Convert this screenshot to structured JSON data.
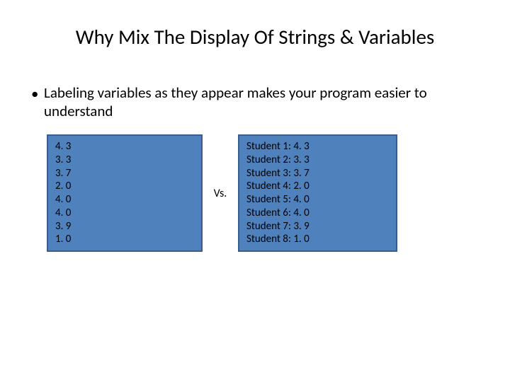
{
  "title": "Why Mix The Display Of Strings & Variables",
  "bullet": "Labeling variables as they appear makes your program easier to understand",
  "vs": "Vs.",
  "left": {
    "values": [
      "4. 3",
      "3. 3",
      "3. 7",
      "2. 0",
      "4. 0",
      "4. 0",
      "3. 9",
      "1. 0"
    ]
  },
  "right": {
    "rows": [
      {
        "label": "Student 1: ",
        "value": "4. 3"
      },
      {
        "label": "Student 2: ",
        "value": "3. 3"
      },
      {
        "label": "Student 3: ",
        "value": "3. 7"
      },
      {
        "label": "Student 4: ",
        "value": "2. 0"
      },
      {
        "label": "Student 5: ",
        "value": "4. 0"
      },
      {
        "label": "Student 6: ",
        "value": "4. 0"
      },
      {
        "label": "Student 7: ",
        "value": "3. 9"
      },
      {
        "label": "Student 8: ",
        "value": "1. 0"
      }
    ]
  }
}
